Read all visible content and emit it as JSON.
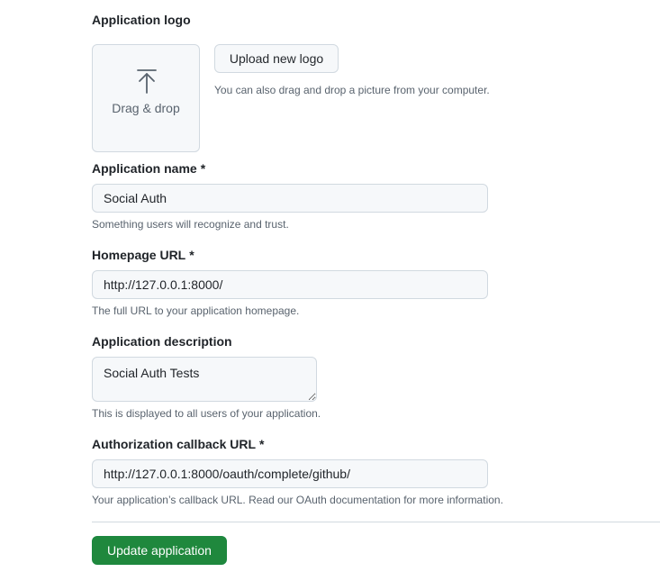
{
  "logo": {
    "label": "Application logo",
    "dropzone_text": "Drag & drop",
    "upload_button": "Upload new logo",
    "note": "You can also drag and drop a picture from your computer."
  },
  "fields": {
    "name": {
      "label": "Application name",
      "required": "*",
      "value": "Social Auth",
      "note": "Something users will recognize and trust."
    },
    "homepage": {
      "label": "Homepage URL",
      "required": "*",
      "value": "http://127.0.0.1:8000/",
      "note": "The full URL to your application homepage."
    },
    "description": {
      "label": "Application description",
      "value": "Social Auth Tests",
      "note": "This is displayed to all users of your application."
    },
    "callback": {
      "label": "Authorization callback URL",
      "required": "*",
      "value": "http://127.0.0.1:8000/oauth/complete/github/",
      "note": "Your application’s callback URL. Read our OAuth documentation for more information."
    }
  },
  "submit": {
    "label": "Update application"
  },
  "icons": {
    "upload": "arrow-up-to-line-icon"
  },
  "colors": {
    "primary_button": "#1f883d",
    "input_background": "#f6f8fa",
    "border": "#d1d9e0",
    "muted_text": "#59636e"
  }
}
